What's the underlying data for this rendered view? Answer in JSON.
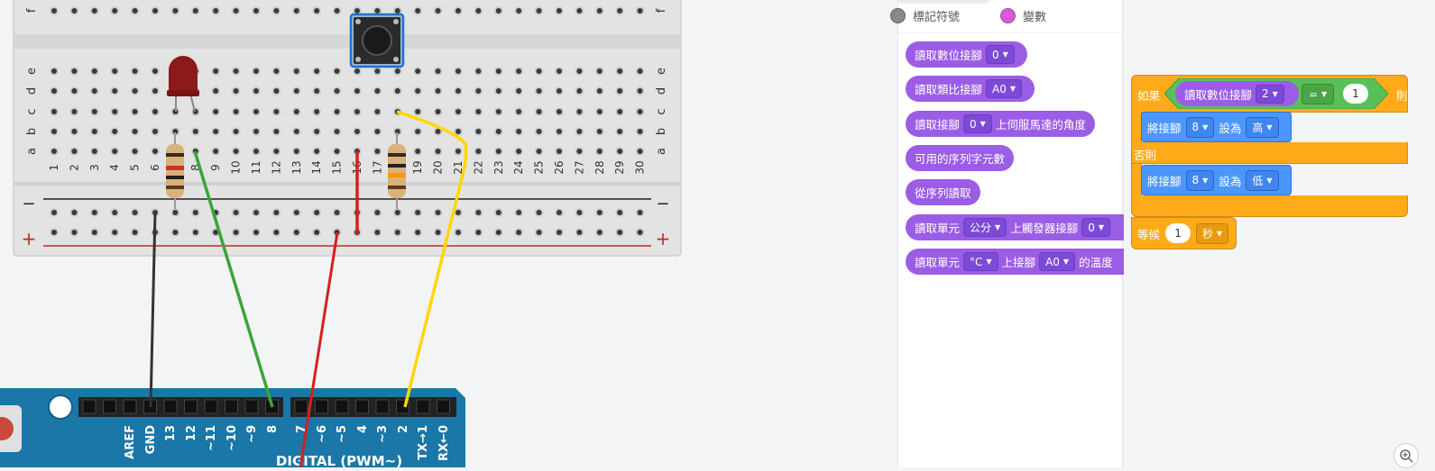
{
  "breadboard": {
    "row_letters_top": [
      "e",
      "d",
      "c",
      "b",
      "a"
    ],
    "row_letter_f": "f",
    "column_numbers": [
      "1",
      "2",
      "3",
      "4",
      "5",
      "6",
      "7",
      "8",
      "9",
      "10",
      "11",
      "12",
      "13",
      "14",
      "15",
      "16",
      "17",
      "18",
      "19",
      "20",
      "21",
      "22",
      "23",
      "24",
      "25",
      "26",
      "27",
      "28",
      "29",
      "30"
    ],
    "rail_minus": "−",
    "rail_plus": "+"
  },
  "arduino": {
    "pin_labels": [
      "AREF",
      "GND",
      "13",
      "12",
      "~11",
      "~10",
      "~9",
      "8",
      "7",
      "~6",
      "~5",
      "4",
      "~3",
      "2",
      "TX→1",
      "RX←0"
    ],
    "digital_label": "DIGITAL (PWM~)"
  },
  "palette": {
    "legend": [
      {
        "label": "標記符號",
        "color": "#888888"
      },
      {
        "label": "變數",
        "color": "#d65cd6"
      }
    ],
    "blocks": [
      {
        "prefix": "讀取數位接腳",
        "dd1": "0",
        "mid": "",
        "dd2": "",
        "suffix": ""
      },
      {
        "prefix": "讀取類比接腳",
        "dd1": "A0",
        "mid": "",
        "dd2": "",
        "suffix": ""
      },
      {
        "prefix": "讀取接腳",
        "dd1": "0",
        "mid": "上伺服馬達的角度",
        "dd2": "",
        "suffix": ""
      },
      {
        "prefix": "可用的序列字元數",
        "dd1": "",
        "mid": "",
        "dd2": "",
        "suffix": ""
      },
      {
        "prefix": "從序列讀取",
        "dd1": "",
        "mid": "",
        "dd2": "",
        "suffix": ""
      },
      {
        "prefix": "讀取單元",
        "dd1": "公分",
        "mid": "上觸發器接腳",
        "dd2": "0",
        "suffix": ""
      },
      {
        "prefix": "讀取單元",
        "dd1": "°C",
        "mid": "上接腳",
        "dd2": "A0",
        "suffix": "的溫度"
      }
    ],
    "colors": {
      "purple": "#9b5de5"
    }
  },
  "script": {
    "if_label": "如果",
    "then_label": "則",
    "else_label": "否則",
    "condition_block": "讀取數位接腳",
    "condition_pin": "2",
    "operator": "=",
    "compare_value": "1",
    "then_action": {
      "prefix": "將接腳",
      "pin": "8",
      "mid": "設為",
      "value": "高"
    },
    "else_action": {
      "prefix": "將接腳",
      "pin": "8",
      "mid": "設為",
      "value": "低"
    },
    "wait": {
      "label": "等候",
      "value": "1",
      "unit": "秒"
    },
    "colors": {
      "control": "#ffab19",
      "output": "#4c97ff",
      "operator": "#59c059",
      "input": "#9b5de5"
    }
  },
  "zoom_icon": "zoom-in-icon"
}
